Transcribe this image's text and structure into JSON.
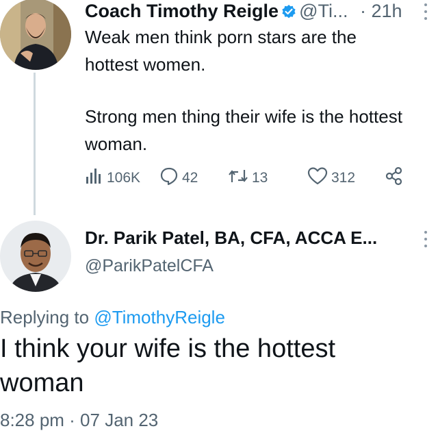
{
  "tweet": {
    "author_name": "Coach Timothy Reigle",
    "handle": "@Ti...",
    "separator": "·",
    "time": "21h",
    "line1": "Weak men think porn stars are the",
    "line2": "hottest women.",
    "line3": "Strong men thing their wife is the hottest",
    "line4": "woman.",
    "stats": {
      "views": "106K",
      "replies": "42",
      "retweets": "13",
      "likes": "312"
    }
  },
  "reply": {
    "author_name": "Dr. Parik Patel, BA, CFA, ACCA E...",
    "handle": "@ParikPatelCFA",
    "replying_prefix": "Replying to",
    "replying_to": "@TimothyReigle",
    "text_line1": "I think your wife is the hottest",
    "text_line2": "woman",
    "timestamp": "8:28 pm · 07 Jan 23"
  },
  "colors": {
    "text": "#0f1419",
    "muted": "#536471",
    "link": "#1d9bf0",
    "verified": "#1d9bf0",
    "thread_line": "#cfd9de"
  },
  "icons": {
    "verified": "verified-badge-icon",
    "views": "bar-chart-icon",
    "reply": "speech-bubble-icon",
    "retweet": "retweet-icon",
    "like": "heart-icon",
    "share": "share-icon",
    "more": "more-vertical-icon"
  }
}
